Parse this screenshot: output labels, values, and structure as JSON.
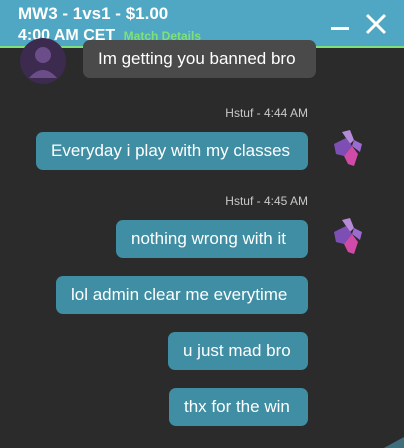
{
  "header": {
    "title": "MW3 - 1vs1 - $1.00",
    "time": "4:00 AM CET",
    "match_link": "Match Details"
  },
  "messages": [
    {
      "side": "in",
      "text": "Im getting you banned bro"
    },
    {
      "side": "out",
      "meta": "Hstuf - 4:44 AM",
      "text": "Everyday i play with my classes"
    },
    {
      "side": "out",
      "meta": "Hstuf - 4:45 AM",
      "text": "nothing wrong with it"
    },
    {
      "side": "out",
      "text": "lol admin clear me everytime"
    },
    {
      "side": "out",
      "text": "u just mad bro"
    },
    {
      "side": "out",
      "text": "thx for the win"
    }
  ],
  "colors": {
    "header_bg": "#4fa7c3",
    "accent_green": "#7fe07a",
    "outgoing_bubble": "#3f8ea3",
    "incoming_bubble": "#4a4a4a",
    "panel_bg": "#2b2b2b"
  }
}
